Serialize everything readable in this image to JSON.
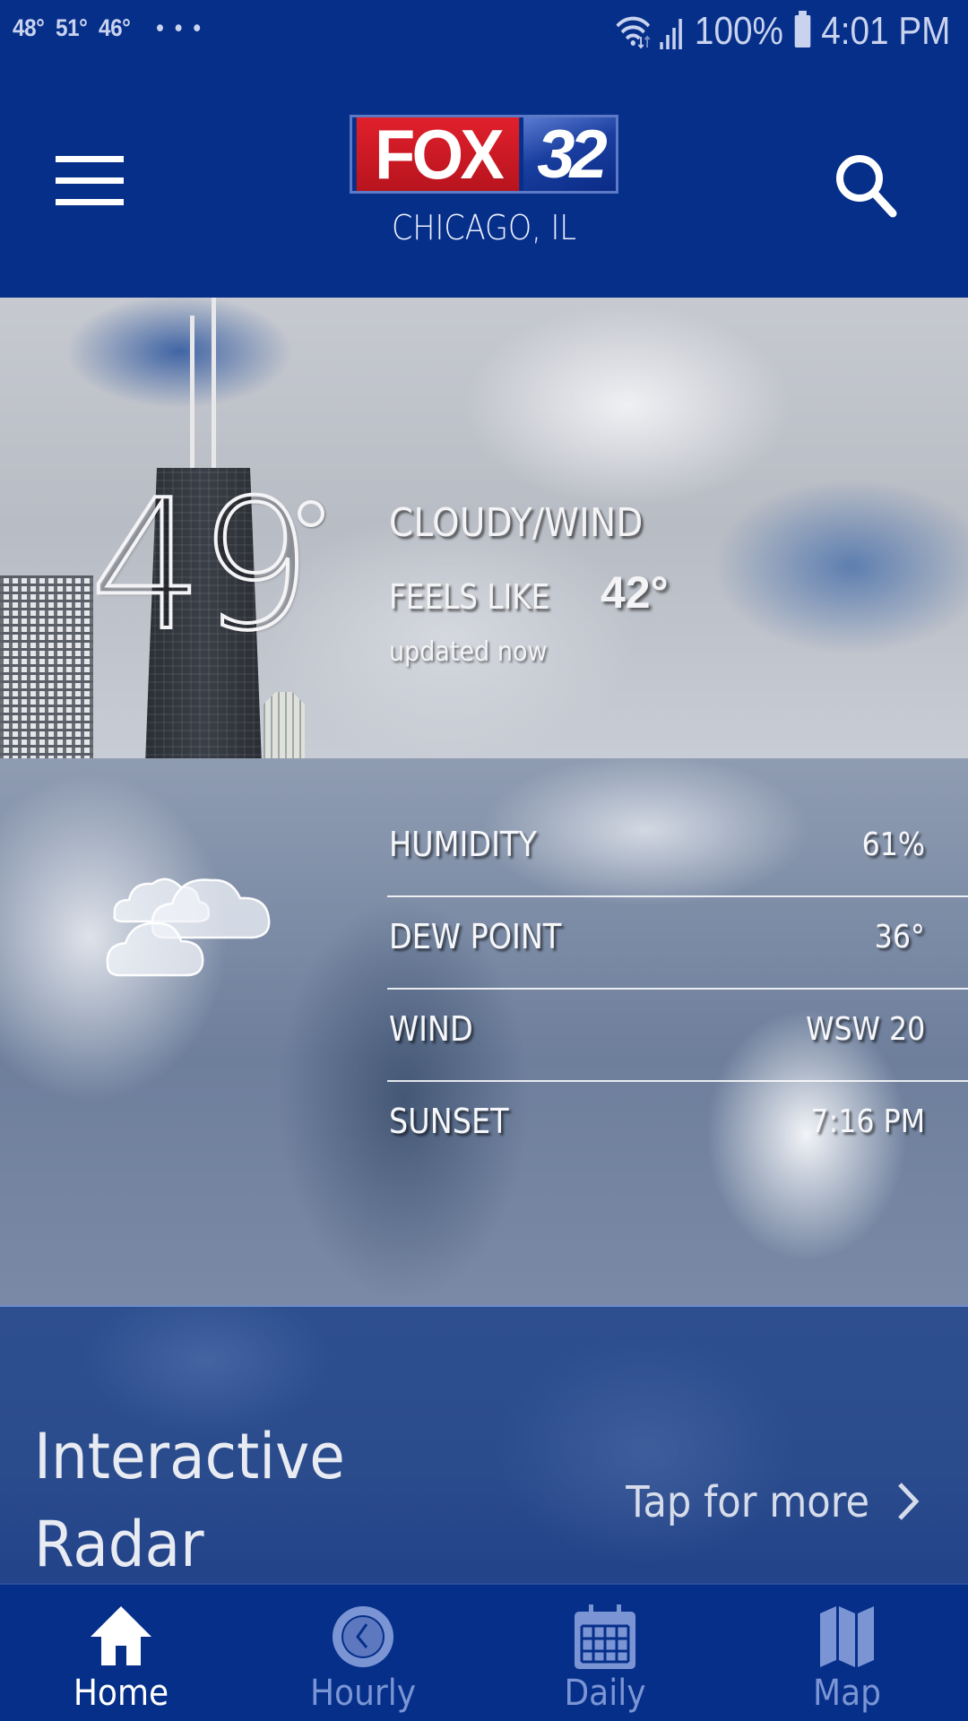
{
  "status_bar": {
    "temps": [
      "48°",
      "51°",
      "46°"
    ],
    "more": "• • •",
    "battery": "100%",
    "time": "4:01 PM",
    "icons": [
      "wifi-icon",
      "signal-icon",
      "battery-icon"
    ]
  },
  "header": {
    "logo_brand": "FOX",
    "logo_channel": "32",
    "location": "CHICAGO, IL",
    "menu_icon": "hamburger-menu-icon",
    "search_icon": "search-icon",
    "colors": {
      "header_bg": "#062f8a",
      "logo_red": "#e0202c",
      "logo_blue": "#1a3fa0"
    }
  },
  "current": {
    "temperature": "49",
    "degree_symbol": "°",
    "condition": "CLOUDY/WIND",
    "feels_like_label": "FEELS LIKE",
    "feels_like_value": "42°",
    "updated": "updated now",
    "condition_icon": "cloudy-icon"
  },
  "details": [
    {
      "label": "HUMIDITY",
      "value": "61%"
    },
    {
      "label": "DEW POINT",
      "value": "36°"
    },
    {
      "label": "WIND",
      "value": "WSW 20"
    },
    {
      "label": "SUNSET",
      "value": "7:16 PM"
    }
  ],
  "radar": {
    "title_line1": "Interactive",
    "title_line2": "Radar",
    "tap_label": "Tap for more"
  },
  "bottom_nav": {
    "items": [
      {
        "label": "Home",
        "icon": "home-icon",
        "active": true
      },
      {
        "label": "Hourly",
        "icon": "clock-icon",
        "active": false
      },
      {
        "label": "Daily",
        "icon": "calendar-icon",
        "active": false
      },
      {
        "label": "Map",
        "icon": "map-icon",
        "active": false
      }
    ],
    "colors": {
      "active": "#ffffff",
      "inactive": "#7b95d4"
    }
  }
}
